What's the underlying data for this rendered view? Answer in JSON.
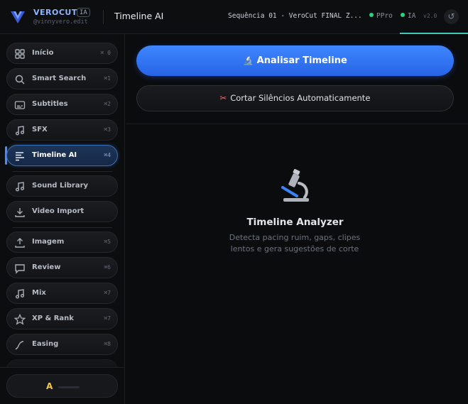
{
  "header": {
    "brand": "VEROCUT",
    "brand_badge": "IA",
    "handle": "@vinnyvero.edit",
    "app_title": "Timeline AI",
    "sequence": "Sequência 01 - VeroCut FINAL Z...",
    "status_ppro": "PPro",
    "status_ia": "IA",
    "version": "v2.0",
    "accent_color": "#3ec8b8"
  },
  "sidebar": {
    "items": [
      {
        "label": "Início",
        "shortcut": "⌘ 0",
        "icon": "grid-icon"
      },
      {
        "label": "Smart Search",
        "shortcut": "⌘1",
        "icon": "search-icon"
      },
      {
        "label": "Subtitles",
        "shortcut": "⌘2",
        "icon": "subtitles-icon"
      },
      {
        "label": "SFX",
        "shortcut": "⌘3",
        "icon": "music-note-icon"
      },
      {
        "label": "Timeline AI",
        "shortcut": "⌘4",
        "icon": "timeline-icon",
        "active": true
      },
      {
        "label": "Sound Library",
        "shortcut": "",
        "icon": "music-note-icon"
      },
      {
        "label": "Video Import",
        "shortcut": "",
        "icon": "download-icon"
      },
      {
        "label": "Imagem",
        "shortcut": "⌘5",
        "icon": "upload-icon"
      },
      {
        "label": "Review",
        "shortcut": "⌘6",
        "icon": "comment-icon"
      },
      {
        "label": "Mix",
        "shortcut": "⌘7",
        "icon": "music-note-icon"
      },
      {
        "label": "XP & Rank",
        "shortcut": "⌘7",
        "icon": "star-icon"
      },
      {
        "label": "Easing",
        "shortcut": "⌘8",
        "icon": "easing-curve-icon"
      }
    ],
    "active_color": "#4f8cff",
    "user_letter": "A",
    "user_letter_color": "#f5c842"
  },
  "main": {
    "primary_button": {
      "icon": "🔬",
      "label": "Analisar Timeline"
    },
    "secondary_button": {
      "icon": "✂",
      "label": "Cortar Silêncios Automaticamente"
    },
    "empty_state": {
      "icon": "microscope-icon",
      "title": "Timeline Analyzer",
      "description": "Detecta pacing ruim, gaps, clipes lentos e gera sugestões de corte"
    },
    "primary_color": "#3f86ff"
  }
}
